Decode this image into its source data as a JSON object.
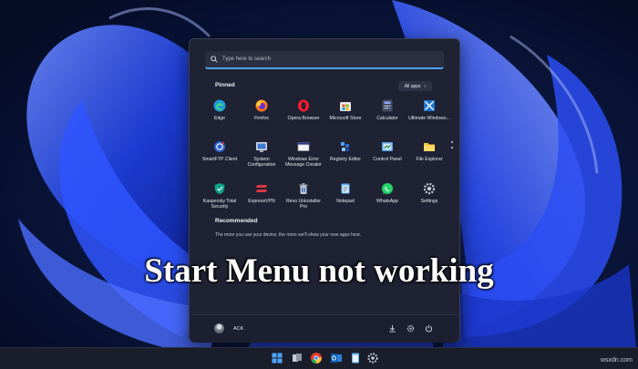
{
  "search": {
    "placeholder": "Type here to search"
  },
  "pinned": {
    "title": "Pinned",
    "all_apps_label": "All apps",
    "apps": [
      {
        "label": "Edge",
        "icon": "edge-icon"
      },
      {
        "label": "Firefox",
        "icon": "firefox-icon"
      },
      {
        "label": "Opera Browser",
        "icon": "opera-icon"
      },
      {
        "label": "Microsoft Store",
        "icon": "store-icon"
      },
      {
        "label": "Calculator",
        "icon": "calculator-icon"
      },
      {
        "label": "Ultimate Windows...",
        "icon": "ultimate-windows-icon"
      },
      {
        "label": "SmartFTP Client",
        "icon": "smartftp-icon"
      },
      {
        "label": "System Configuration",
        "icon": "system-config-icon"
      },
      {
        "label": "Windows Error Message Creator",
        "icon": "error-creator-icon"
      },
      {
        "label": "Registry Editor",
        "icon": "registry-icon"
      },
      {
        "label": "Control Panel",
        "icon": "control-panel-icon"
      },
      {
        "label": "File Explorer",
        "icon": "folder-icon"
      },
      {
        "label": "Kaspersky Total Security",
        "icon": "kaspersky-icon"
      },
      {
        "label": "ExpressVPN",
        "icon": "expressvpn-icon"
      },
      {
        "label": "Revo Uninstaller Pro",
        "icon": "revo-icon"
      },
      {
        "label": "Notepad",
        "icon": "notepad-icon"
      },
      {
        "label": "WhatsApp",
        "icon": "whatsapp-icon"
      },
      {
        "label": "Settings",
        "icon": "settings-icon"
      }
    ]
  },
  "recommended": {
    "title": "Recommended",
    "text": "The more you use your device, the more we'll show your new apps here."
  },
  "footer": {
    "user_name": "ACK"
  },
  "overlay_title": "Start Menu not working",
  "watermark": "wsxdn.com",
  "taskbar": {
    "icons": [
      "windows-logo-icon",
      "task-view-icon",
      "chrome-icon",
      "outlook-icon",
      "notepad-icon",
      "settings-icon"
    ]
  },
  "colors": {
    "accent": "#4ca6ff",
    "panel": "#1f2233",
    "wallpaper": "#071233",
    "bloom": "#1f49e6"
  }
}
